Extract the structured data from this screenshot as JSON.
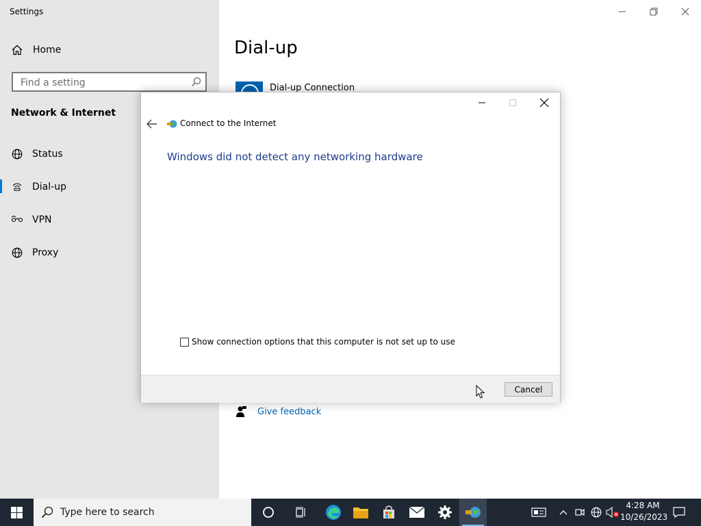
{
  "settings_window": {
    "title": "Settings",
    "home_label": "Home",
    "search_placeholder": "Find a setting",
    "section_heading": "Network & Internet",
    "nav_items": [
      {
        "label": "Status",
        "icon": "globe-icon"
      },
      {
        "label": "Dial-up",
        "icon": "dialup-icon",
        "selected": true
      },
      {
        "label": "VPN",
        "icon": "vpn-icon"
      },
      {
        "label": "Proxy",
        "icon": "globe-icon"
      }
    ],
    "page_title": "Dial-up",
    "connection_label": "Dial-up Connection",
    "feedback_label": "Give feedback",
    "accent_color": "#0078d7"
  },
  "dialog": {
    "title": "Connect to the Internet",
    "heading": "Windows did not detect any networking hardware",
    "checkbox_label": "Show connection options that this computer is not set up to use",
    "checkbox_checked": false,
    "cancel_label": "Cancel"
  },
  "taskbar": {
    "search_placeholder": "Type here to search",
    "pinned": [
      "cortana-icon",
      "task-view-icon",
      "edge-icon",
      "file-explorer-icon",
      "store-icon",
      "mail-icon",
      "settings-icon",
      "network-connect-icon"
    ],
    "time": "4:28 AM",
    "date": "10/26/2023"
  }
}
